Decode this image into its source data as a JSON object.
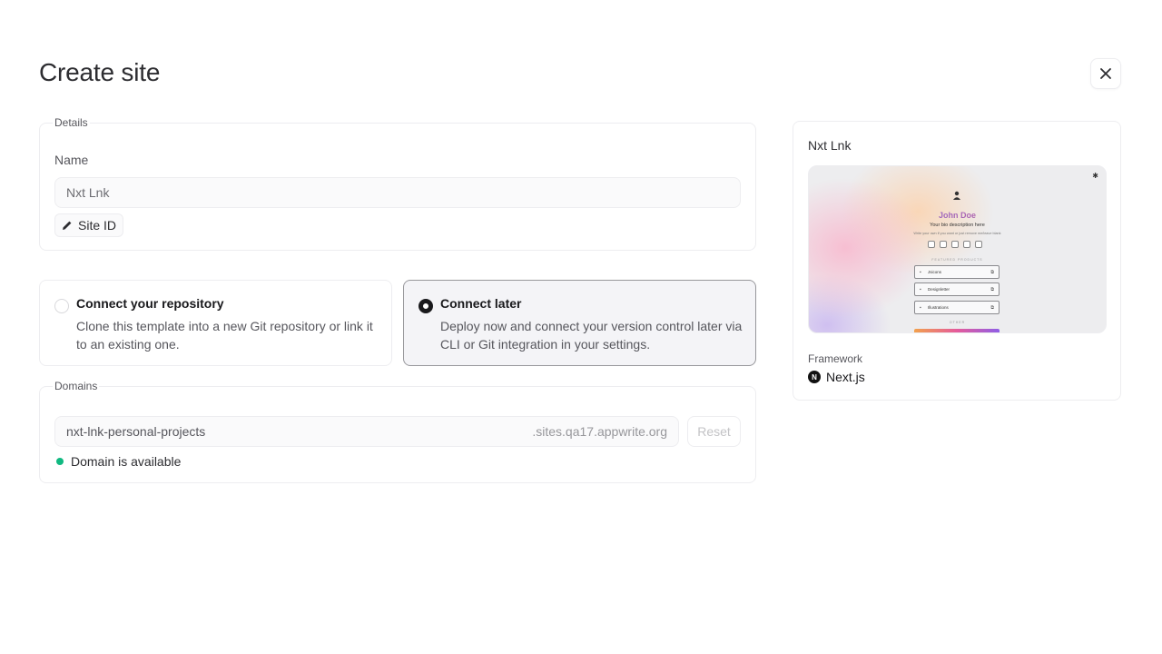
{
  "header": {
    "title": "Create site",
    "close_icon": "close-icon"
  },
  "details": {
    "legend": "Details",
    "name_label": "Name",
    "name_value": "Nxt Lnk",
    "site_id_label": "Site ID",
    "site_id_icon": "pencil-icon"
  },
  "connect_options": [
    {
      "title": "Connect your repository",
      "description": "Clone this template into a new Git repository or link it to an existing one.",
      "selected": false
    },
    {
      "title": "Connect later",
      "description": "Deploy now and connect your version control later via CLI or Git integration in your settings.",
      "selected": true
    }
  ],
  "domains": {
    "legend": "Domains",
    "value": "nxt-lnk-personal-projects",
    "suffix": ".sites.qa17.appwrite.org",
    "reset_label": "Reset",
    "status": "Domain is available",
    "status_color": "#10b981"
  },
  "template_card": {
    "title": "Nxt Lnk",
    "preview": {
      "name": "John Doe",
      "bio": "Your bio description here",
      "sub": "Write your own if you want or just remove me/leave blank",
      "featured_label": "FEATURED PRODUCTS",
      "links": [
        "Jsicons",
        "Designletter",
        "Illustrations"
      ],
      "other_label": "OTHER"
    },
    "framework_label": "Framework",
    "framework_value": "Next.js",
    "framework_logo_letter": "N"
  }
}
